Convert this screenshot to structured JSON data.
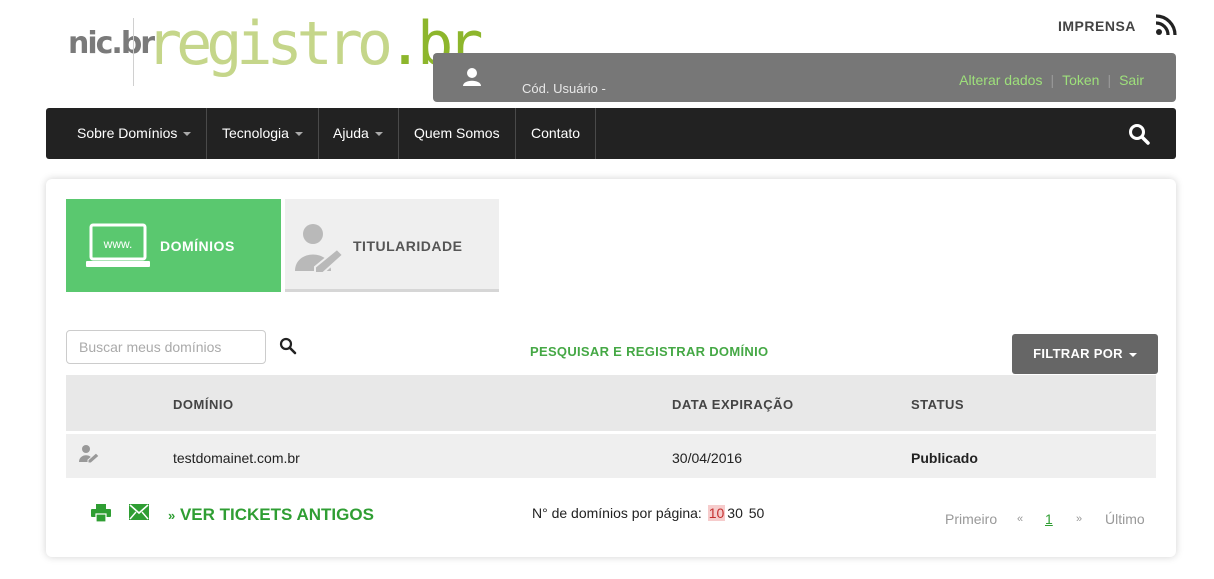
{
  "logo": {
    "nic": "nic.br",
    "registro": "registro",
    "br": ".br"
  },
  "header": {
    "imprensa": "IMPRENSA"
  },
  "userbar": {
    "cod_usuario": "Cód. Usuário -",
    "alterar": "Alterar dados",
    "token": "Token",
    "sair": "Sair",
    "separator": "|"
  },
  "nav": {
    "items": [
      {
        "label": "Sobre Domínios"
      },
      {
        "label": "Tecnologia"
      },
      {
        "label": "Ajuda"
      },
      {
        "label": "Quem Somos"
      },
      {
        "label": "Contato"
      }
    ]
  },
  "tabs": {
    "dominios": "DOMÍNIOS",
    "titularidade": "TITULARIDADE",
    "www": "www."
  },
  "search": {
    "placeholder": "Buscar meus domínios"
  },
  "actions": {
    "pesquisar": "PESQUISAR E REGISTRAR DOMÍNIO",
    "filtrar": "FILTRAR POR"
  },
  "table": {
    "headers": {
      "dominio": "DOMÍNIO",
      "data_expiracao": "DATA EXPIRAÇÃO",
      "status": "STATUS"
    },
    "rows": [
      {
        "dominio": "testdomainet.com.br",
        "data_expiracao": "30/04/2016",
        "status": "Publicado"
      }
    ]
  },
  "footer": {
    "tickets": "VER TICKETS ANTIGOS",
    "tickets_prefix": "»",
    "per_page_label": "N° de domínios por página:",
    "per_page_options": [
      "10",
      "30",
      "50"
    ],
    "per_page_selected": "10",
    "pager": {
      "first": "Primeiro",
      "prev": "«",
      "page": "1",
      "next": "»",
      "last": "Último"
    }
  },
  "colors": {
    "accent_green": "#5ac86f",
    "link_green": "#2f9e33",
    "nav_bg": "#222222",
    "userbar_bg": "#777777"
  }
}
